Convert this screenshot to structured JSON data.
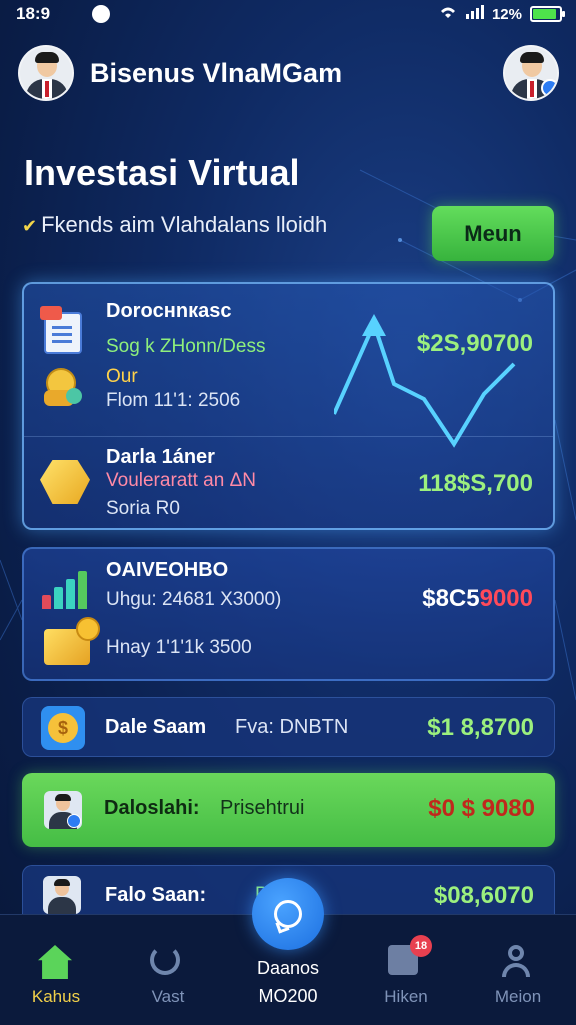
{
  "status_bar": {
    "time": "18:9",
    "battery": "12%",
    "battery_level": 0.9
  },
  "header": {
    "app_title": "Bisenus VlnaMGam"
  },
  "page": {
    "title": "Investasi Virtual",
    "subtitle": "Fkends aim Vlahdalans lloidh",
    "menu_button": "Meun"
  },
  "investments": [
    {
      "name": "Doroснnкasc",
      "detail": "Sog k ZHonn/Dess",
      "amount": "$2S,90700",
      "sub_label": "Our",
      "sub_detail": "Flom 11'1: 2506"
    },
    {
      "name": "Darla 1áner",
      "detail": "Vouleraratt an ΔN",
      "sub_detail": "Soria R0",
      "amount": "118$S,700"
    },
    {
      "name": "OAIVEOHBO",
      "detail": "Uhgu: 24681 X3000)",
      "amount_white": "$8C5",
      "amount_red": "9000",
      "sub_detail": "Hnay 1'1'1k 3500"
    },
    {
      "name": "Dale Saam",
      "detail": "Fva: DNBTN",
      "amount": "$1 8,8700"
    },
    {
      "name": "Daloslahi:",
      "detail": "Prisehtrui",
      "amount": "$0 $ 9080"
    },
    {
      "name": "Falo Saan:",
      "detail": "Pa",
      "amount": "$08,6070"
    }
  ],
  "bottom_nav": {
    "items": [
      {
        "label": "Kahus"
      },
      {
        "label": "Vast"
      },
      {
        "label": "Hiken",
        "badge": "18"
      },
      {
        "label": "Meion"
      }
    ],
    "center_label_1": "Daanos",
    "center_label_2": "МО200"
  },
  "colors": {
    "accent_green": "#4ccf4c",
    "background": "#0f2a63",
    "card_border": "#78beff",
    "amount_green": "#9cf07e",
    "amount_red": "#c0281c"
  }
}
